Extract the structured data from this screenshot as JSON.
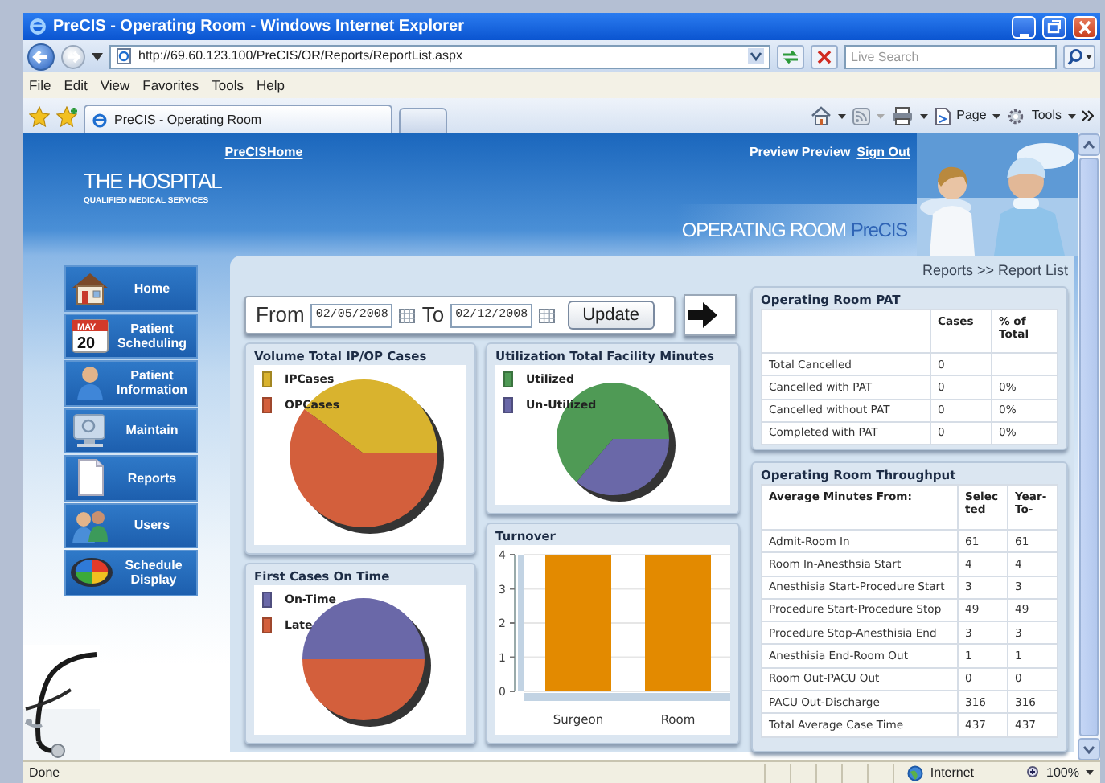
{
  "window": {
    "title": "PreCIS - Operating Room - Windows Internet Explorer"
  },
  "address_bar": {
    "url": "http://69.60.123.100/PreCIS/OR/Reports/ReportList.aspx"
  },
  "search": {
    "placeholder": "Live Search"
  },
  "menu": [
    "File",
    "Edit",
    "View",
    "Favorites",
    "Tools",
    "Help"
  ],
  "tabs": [
    {
      "label": "PreCIS - Operating Room",
      "selected": true
    }
  ],
  "command_bar": [
    "Page",
    "Tools"
  ],
  "header": {
    "home_link": "PreCISHome",
    "logo_title": "THE HOSPITAL",
    "logo_subtitle": "QUALIFIED MEDICAL SERVICES",
    "user": "Preview Preview",
    "sign_out": "Sign Out",
    "banner": "OPERATING ROOM",
    "banner_brand": "PreCIS"
  },
  "sidebar": {
    "items": [
      {
        "label": "Home",
        "kind": "house"
      },
      {
        "label": "Patient Scheduling",
        "kind": "calendar",
        "icon_month": "MAY",
        "icon_day": "20"
      },
      {
        "label": "Patient Information",
        "kind": "person"
      },
      {
        "label": "Maintain",
        "kind": "monitor"
      },
      {
        "label": "Reports",
        "kind": "document"
      },
      {
        "label": "Users",
        "kind": "people"
      },
      {
        "label": "Schedule Display",
        "kind": "disc"
      }
    ]
  },
  "breadcrumb": "Reports >> Report List",
  "date_filter": {
    "from_label": "From",
    "from": "02/05/2008",
    "to_label": "To",
    "to": "02/12/2008",
    "button": "Update"
  },
  "charts": [
    {
      "title": "Volume Total IP/OP Cases",
      "kind": "pie",
      "legend": [
        {
          "label": "IPCases",
          "color": "#d9b32e"
        },
        {
          "label": "OPCases",
          "color": "#d35f3c"
        }
      ]
    },
    {
      "title": "First Cases On Time",
      "kind": "pie",
      "legend": [
        {
          "label": "On-Time",
          "color": "#6a68a8"
        },
        {
          "label": "Late",
          "color": "#d35f3c"
        }
      ]
    },
    {
      "title": "Utilization Total Facility Minutes",
      "kind": "pie",
      "legend": [
        {
          "label": "Utilized",
          "color": "#4f9a55"
        },
        {
          "label": "Un-Utilized",
          "color": "#6a68a8"
        }
      ]
    },
    {
      "title": "Turnover",
      "kind": "bar",
      "chart_data": {
        "type": "bar",
        "categories": [
          "Surgeon",
          "Room"
        ],
        "series": [
          {
            "color": "#e38a00",
            "values": [
              4,
              4
            ]
          }
        ],
        "ylim": [
          0,
          4
        ],
        "yticks": [
          0,
          1,
          2,
          3,
          4
        ],
        "grid": true
      }
    }
  ],
  "pat_table": {
    "title": "Operating Room PAT",
    "columns": [
      "Cases",
      "% of Total"
    ],
    "rows": [
      {
        "label": "Total Cancelled",
        "cases": "0"
      },
      {
        "label": "Cancelled with PAT",
        "cases": "0",
        "percent": "0%"
      },
      {
        "label": "Cancelled without PAT",
        "cases": "0",
        "percent": "0%"
      },
      {
        "label": "Completed with PAT",
        "cases": "0",
        "percent": "0%"
      }
    ]
  },
  "throughput_table": {
    "title": "Operating Room Throughput",
    "columns": [
      "Average Minutes From:",
      "Selected",
      "Year-To-"
    ],
    "rows": [
      [
        "Admit-Room In",
        "61",
        "61"
      ],
      [
        "Room In-Anesthsia Start",
        "4",
        "4"
      ],
      [
        "Anesthisia Start-Procedure Start",
        "3",
        "3"
      ],
      [
        "Procedure Start-Procedure Stop",
        "49",
        "49"
      ],
      [
        "Procedure Stop-Anesthisia End",
        "3",
        "3"
      ],
      [
        "Anesthisia End-Room Out",
        "1",
        "1"
      ],
      [
        "Room Out-PACU Out",
        "0",
        "0"
      ],
      [
        "PACU Out-Discharge",
        "316",
        "316"
      ],
      [
        "Total Average Case Time",
        "437",
        "437"
      ]
    ]
  },
  "status_bar": {
    "text": "Done",
    "zone": "Internet",
    "zoom": "100%"
  }
}
